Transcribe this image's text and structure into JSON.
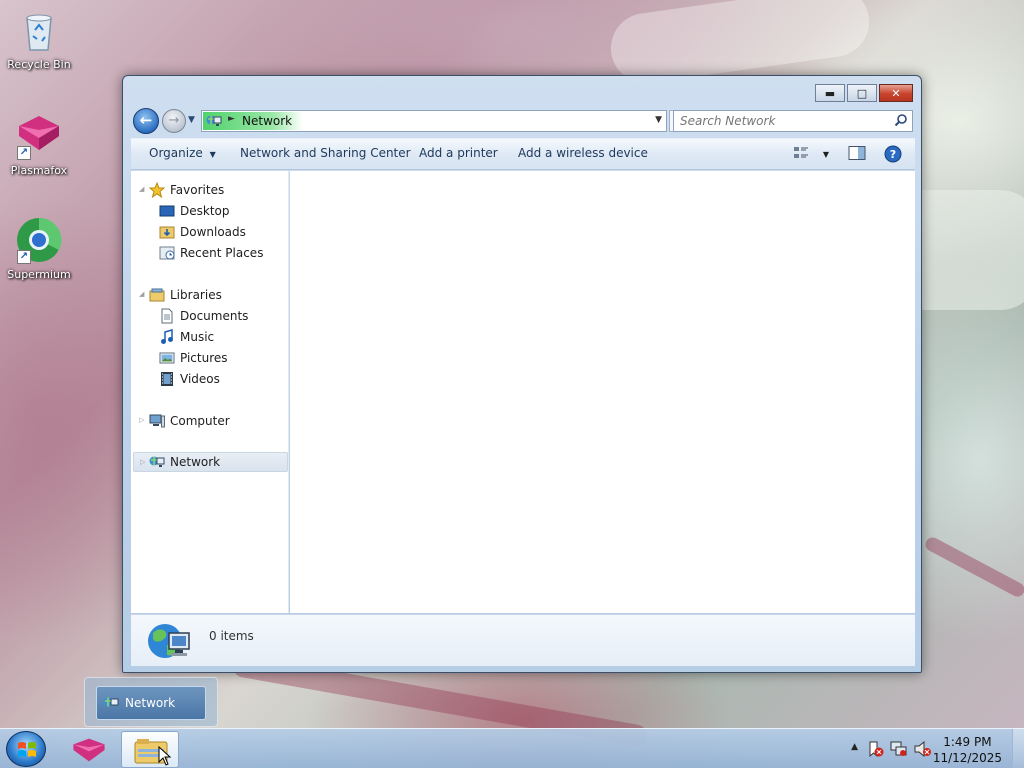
{
  "desktop": {
    "icons": [
      {
        "label": "Recycle Bin",
        "icon": "recycle-bin-icon"
      },
      {
        "label": "Plasmafox",
        "icon": "plasmafox-icon"
      },
      {
        "label": "Supermium",
        "icon": "supermium-icon"
      }
    ]
  },
  "window": {
    "address": {
      "location": "Network",
      "icon": "network-icon"
    },
    "search": {
      "placeholder": "Search Network"
    },
    "toolbar": {
      "organize": "Organize",
      "network_sharing": "Network and Sharing Center",
      "add_printer": "Add a printer",
      "add_wireless": "Add a wireless device"
    },
    "nav": {
      "favorites": {
        "label": "Favorites",
        "items": [
          "Desktop",
          "Downloads",
          "Recent Places"
        ]
      },
      "libraries": {
        "label": "Libraries",
        "items": [
          "Documents",
          "Music",
          "Pictures",
          "Videos"
        ]
      },
      "computer": "Computer",
      "network": "Network"
    },
    "details": {
      "item_count": "0 items"
    }
  },
  "taskbar": {
    "thumbnail_title": "Network",
    "clock": {
      "time": "1:49 PM",
      "date": "11/12/2025"
    }
  },
  "colors": {
    "accent": "#2c6fc2",
    "address_progress": "#4fd26b",
    "close_button": "#c7442d"
  }
}
